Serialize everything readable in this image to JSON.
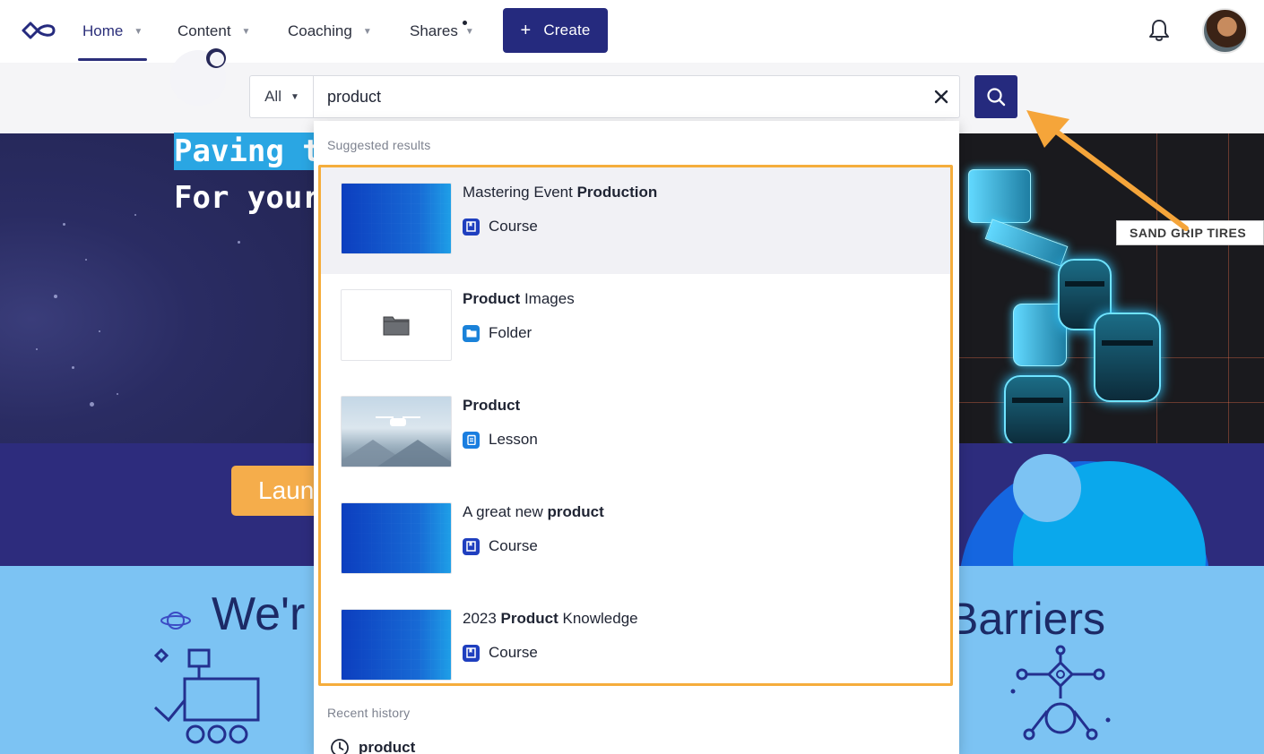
{
  "nav": {
    "items": [
      {
        "label": "Home",
        "active": true
      },
      {
        "label": "Content"
      },
      {
        "label": "Coaching"
      },
      {
        "label": "Shares",
        "has_dot": true
      }
    ],
    "create_label": "Create",
    "logo_icon": "infinity-logo",
    "bell_icon": "bell-icon"
  },
  "search": {
    "scope": "All",
    "query": "product",
    "clear_icon": "close-icon",
    "search_icon": "search-icon"
  },
  "dropdown": {
    "suggested_label": "Suggested results",
    "results": [
      {
        "title_pre": "Mastering Event ",
        "title_bold": "Production",
        "title_post": "",
        "type": "Course",
        "thumb": "pattern"
      },
      {
        "title_pre": "",
        "title_bold": "Product",
        "title_post": " Images",
        "type": "Folder",
        "thumb": "folder"
      },
      {
        "title_pre": "",
        "title_bold": "Product",
        "title_post": "",
        "type": "Lesson",
        "thumb": "photo"
      },
      {
        "title_pre": "A great new ",
        "title_bold": "product",
        "title_post": "",
        "type": "Course",
        "thumb": "pattern"
      },
      {
        "title_pre": "2023 ",
        "title_bold": "Product",
        "title_post": " Knowledge",
        "type": "Course",
        "thumb": "pattern"
      }
    ],
    "recent_label": "Recent history",
    "recent_items": [
      "product"
    ]
  },
  "background": {
    "hero_line1": "Paving t",
    "hero_line2": "For your",
    "launch_label": "Laun",
    "lower_left_text": "We'r",
    "lower_right_text": "Barriers",
    "tire_label": "SAND GRIP TIRES"
  },
  "colors": {
    "brand_navy": "#252a7e",
    "highlight_orange": "#f5ad3c",
    "hero_blue": "#2aa6e3",
    "launch_orange": "#f5ad4b",
    "page_band_purple": "#2d2c7d",
    "page_light_blue": "#7cc3f3"
  }
}
